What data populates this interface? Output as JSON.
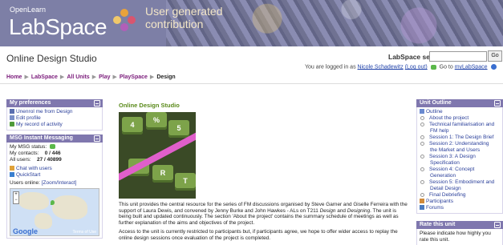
{
  "header": {
    "logo_small": "OpenLearn",
    "logo_big": "LabSpace",
    "tagline_line1": "User generated",
    "tagline_line2": "contribution"
  },
  "site_title": "Online Design Studio",
  "search": {
    "label": "LabSpace search:",
    "value": "",
    "button": "Go"
  },
  "login": {
    "prefix": "You are logged in as",
    "user": "Nicole Schadewitz",
    "logout": "(Log out)",
    "goto": "Go to",
    "mylabspace": "myLabSpace"
  },
  "breadcrumb": [
    "Home",
    "LabSpace",
    "All Units",
    "Play",
    "PlaySpace",
    "Design"
  ],
  "preferences": {
    "title": "My preferences",
    "items": [
      "Unenrol me from Design",
      "Edit profile",
      "My record of activity"
    ]
  },
  "msg": {
    "title": "MSG Instant Messaging",
    "status_label": "My MSG status:",
    "contacts_label": "My contacts:",
    "contacts_value": "0 / 446",
    "users_label": "All users:",
    "users_value": "27 / 40899",
    "chat": "Chat with users",
    "quickstart": "QuickStart",
    "online_label": "Users online:",
    "online_link": "[Zoom/Interact]",
    "map_brand": "Google",
    "map_terms": "Terms of Use"
  },
  "content": {
    "title": "Online Design Studio",
    "para1_a": "This unit provides the central resource for the series of FM discussions organised by Steve Garner and Giselle Ferreira with the support of Laura Dewis, and convened by Jenny Burke and John Hawkes - ALs on T211 ",
    "para1_i1": "Design",
    "para1_b": " and ",
    "para1_i2": "Designing",
    "para1_c": ". The unit is being built and updated continuously. The section 'About the project' contains the summary schedule of meetings as well as further explanation of the aims and objectives of the project.",
    "para2": "Access to the unit is currently restricted to participants but, if participants agree, we hope to offer wider access to replay the online design sessions once evaluation of the project is completed.",
    "photo_keys": [
      "4",
      "%",
      "5",
      "E",
      "R",
      "T"
    ]
  },
  "outline": {
    "title": "Unit Outline",
    "head": "Outline",
    "items": [
      "About the project",
      "Technical familiarisation and",
      "FM help",
      "Session 1: The Design Brief",
      "Session 2: Understanding",
      "the Market and Users",
      "Session 3: A Design",
      "Specification",
      "Session 4: Concept",
      "Generation",
      "Session 5: Embodiment and",
      "Detail Design",
      "Final Debriefing"
    ],
    "participants": "Participants",
    "forums": "Forums"
  },
  "rate": {
    "title": "Rate this unit",
    "line1": "Please indicate how highly you",
    "line2": "rate this unit."
  },
  "colors": {
    "header_bg": "#7d7fa6",
    "block_head": "#7f77ae",
    "breadcrumb": "#7a1a7a",
    "content_title": "#5a8a1a",
    "link": "#2a3f9a"
  }
}
